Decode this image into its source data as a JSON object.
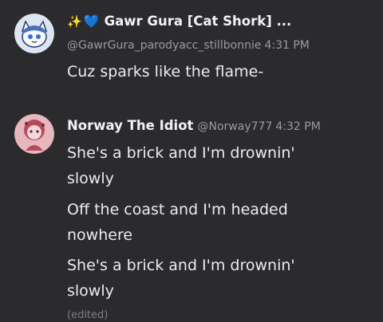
{
  "post1": {
    "display_name": "Gawr Gura [Cat Shork] ...",
    "handle": "@GawrGura_parodyacc_stillbonnie",
    "time": "4:31 PM",
    "message": "Cuz sparks like the flame-",
    "name_prefix_sparkle": "✨",
    "name_prefix_heart": "💙",
    "avatar_icon": "cat-shark-avatar"
  },
  "post2": {
    "display_name": "Norway The Idiot",
    "handle": "@Norway777",
    "time": "4:32 PM",
    "messages": [
      "She's a brick and I'm drownin' slowly",
      "Off the coast and I'm headed nowhere",
      "She's a brick and I'm drownin' slowly"
    ],
    "edited_label": "(edited)",
    "avatar_icon": "pink-character-avatar"
  },
  "colors": {
    "background": "#2b2b2e",
    "text": "#ececee",
    "muted": "#9a9aa0"
  }
}
